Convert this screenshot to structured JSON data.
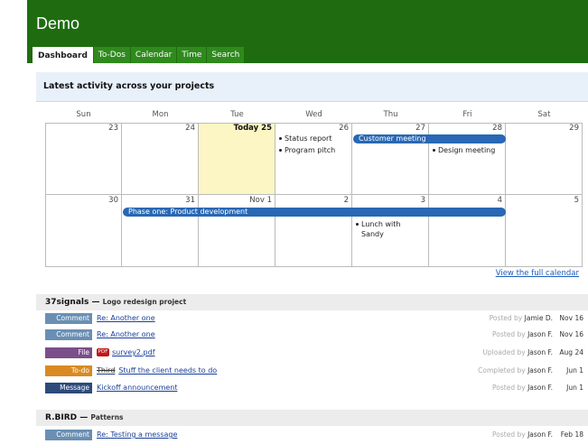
{
  "app": {
    "title": "Demo"
  },
  "tabs": [
    {
      "label": "Dashboard",
      "active": true
    },
    {
      "label": "To-Dos"
    },
    {
      "label": "Calendar"
    },
    {
      "label": "Time"
    },
    {
      "label": "Search"
    }
  ],
  "activity": {
    "title": "Latest activity across your projects"
  },
  "calendar": {
    "days_of_week": [
      "Sun",
      "Mon",
      "Tue",
      "Wed",
      "Thu",
      "Fri",
      "Sat"
    ],
    "week1": [
      "23",
      "24",
      "Today 25",
      "26",
      "27",
      "28",
      "29"
    ],
    "week2": [
      "30",
      "31",
      "Nov 1",
      "2",
      "3",
      "4",
      "5"
    ],
    "events": {
      "status_report": "Status report",
      "program_pitch": "Program pitch",
      "customer_meeting": "Customer meeting",
      "design_meeting": "Design meeting",
      "phase_one": "Phase one: Product development",
      "lunch_line1": "Lunch with",
      "lunch_line2": "Sandy"
    },
    "full_calendar_link": "View the full calendar",
    "colors": {
      "event_bar": "#2868b4",
      "today": "#fbf6c4"
    }
  },
  "projects": [
    {
      "name": "37signals —",
      "desc": "Logo redesign project",
      "items": [
        {
          "type": "Comment",
          "title": "Re: Another one",
          "action": "Posted by",
          "user": "Jamie D.",
          "date": "Nov 16"
        },
        {
          "type": "Comment",
          "title": "Re: Another one",
          "action": "Posted by",
          "user": "Jason F.",
          "date": "Nov 16"
        },
        {
          "type": "File",
          "file_icon": "PDF",
          "title": "survey2.pdf",
          "action": "Uploaded by",
          "user": "Jason F.",
          "date": "Aug 24"
        },
        {
          "type": "To-do",
          "prefix": "Third",
          "title": "Stuff the client needs to do",
          "action": "Completed by",
          "user": "Jason F.",
          "date": "Jun 1"
        },
        {
          "type": "Message",
          "title": "Kickoff announcement",
          "action": "Posted by",
          "user": "Jason F.",
          "date": "Jun 1"
        }
      ]
    },
    {
      "name": "R.BIRD —",
      "desc": "Patterns",
      "items": [
        {
          "type": "Comment",
          "title": "Re: Testing a message",
          "action": "Posted by",
          "user": "Jason F.",
          "date": "Feb 18"
        }
      ]
    }
  ],
  "colors": {
    "header": "#1f6c10",
    "tab": "#2f8a1d",
    "comment": "#6a8fb3",
    "file": "#7a4f89",
    "todo": "#d98a22",
    "message": "#2d4a7a"
  }
}
